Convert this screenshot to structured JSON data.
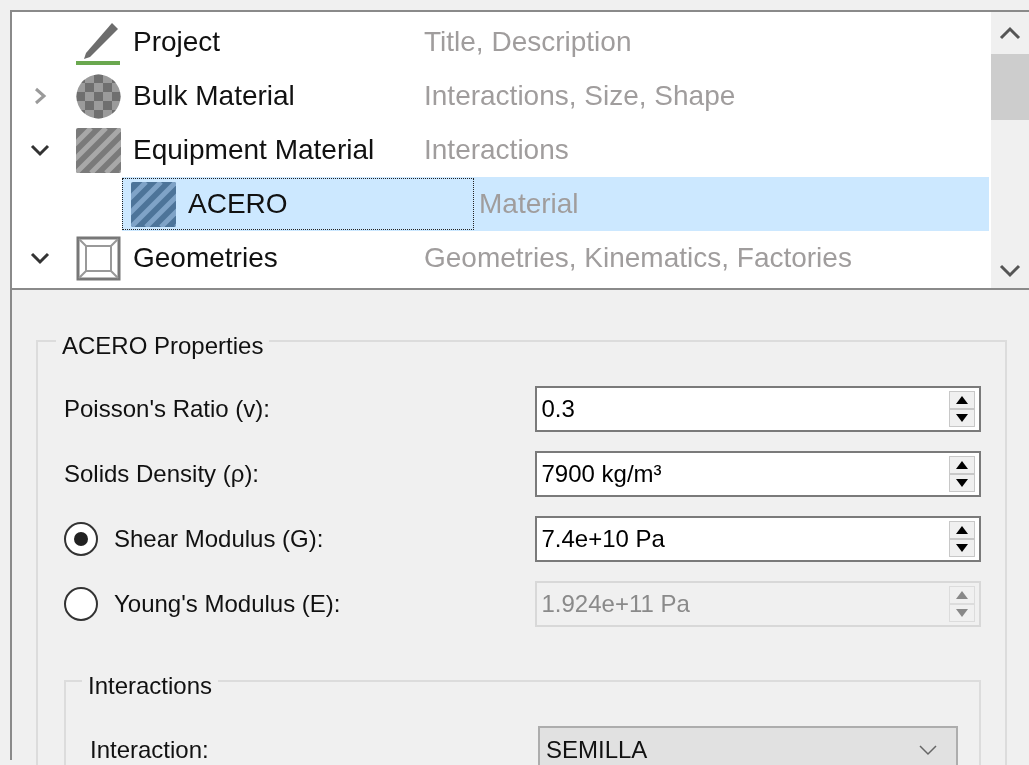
{
  "tree": {
    "items": [
      {
        "label": "Project",
        "description": "Title, Description",
        "kind": "project",
        "selected": false
      },
      {
        "label": "Bulk Material",
        "description": "Interactions, Size, Shape",
        "kind": "bulk",
        "expanded": false,
        "selected": false
      },
      {
        "label": "Equipment Material",
        "description": "Interactions",
        "kind": "equipment",
        "expanded": true,
        "selected": false,
        "children": [
          {
            "label": "ACERO",
            "description": "Material",
            "kind": "material",
            "selected": true
          }
        ]
      },
      {
        "label": "Geometries",
        "description": "Geometries, Kinematics, Factories",
        "kind": "geometry",
        "expanded": true,
        "selected": false
      }
    ]
  },
  "properties": {
    "title": "ACERO Properties",
    "rows": [
      {
        "kind": "plain",
        "label": "Poisson's Ratio (v):",
        "value": "0.3",
        "disabled": false
      },
      {
        "kind": "plain",
        "label": "Solids Density (ρ):",
        "value": "7900 kg/m³",
        "disabled": false
      },
      {
        "kind": "radio",
        "label": "Shear Modulus (G):",
        "value": "7.4e+10 Pa",
        "disabled": false,
        "selected": true
      },
      {
        "kind": "radio",
        "label": "Young's Modulus (E):",
        "value": "1.924e+11 Pa",
        "disabled": true,
        "selected": false
      }
    ],
    "interactions": {
      "title": "Interactions",
      "label": "Interaction:",
      "value": "SEMILLA"
    }
  }
}
